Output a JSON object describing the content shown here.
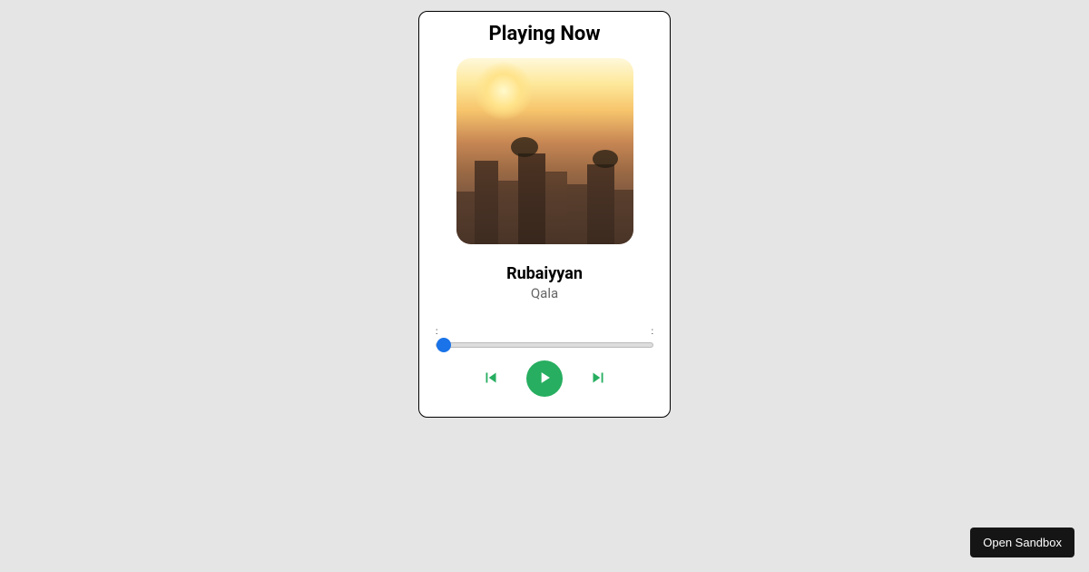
{
  "header": {
    "title": "Playing Now"
  },
  "track": {
    "title": "Rubaiyyan",
    "artist": "Qala"
  },
  "time": {
    "current": ":",
    "total": ":"
  },
  "progress": {
    "value": 0,
    "min": 0,
    "max": 100
  },
  "controls": {
    "prev_label": "Previous",
    "play_label": "Play",
    "next_label": "Next"
  },
  "footer": {
    "sandbox_button": "Open Sandbox"
  }
}
